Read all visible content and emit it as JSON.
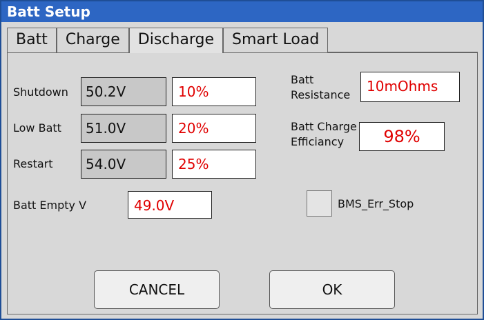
{
  "window": {
    "title": "Batt Setup"
  },
  "tabs": [
    {
      "label": "Batt"
    },
    {
      "label": "Charge"
    },
    {
      "label": "Discharge"
    },
    {
      "label": "Smart Load"
    }
  ],
  "active_tab": "Discharge",
  "discharge": {
    "shutdown": {
      "label": "Shutdown",
      "voltage": "50.2V",
      "percent": "10%"
    },
    "low_batt": {
      "label": "Low Batt",
      "voltage": "51.0V",
      "percent": "20%"
    },
    "restart": {
      "label": "Restart",
      "voltage": "54.0V",
      "percent": "25%"
    },
    "batt_empty": {
      "label": "Batt Empty V",
      "value": "49.0V"
    },
    "batt_resistance": {
      "label_line1": "Batt",
      "label_line2": "Resistance",
      "value": "10mOhms"
    },
    "batt_charge_efficiency": {
      "label_line1": "Batt Charge",
      "label_line2": "Efficiancy",
      "value": "98%"
    },
    "bms_err_stop": {
      "label": "BMS_Err_Stop",
      "checked": false
    }
  },
  "buttons": {
    "cancel": "CANCEL",
    "ok": "OK"
  },
  "colors": {
    "title_bar": "#2d66c3",
    "value_red": "#e00000",
    "panel_bg": "#d8d8d8"
  }
}
